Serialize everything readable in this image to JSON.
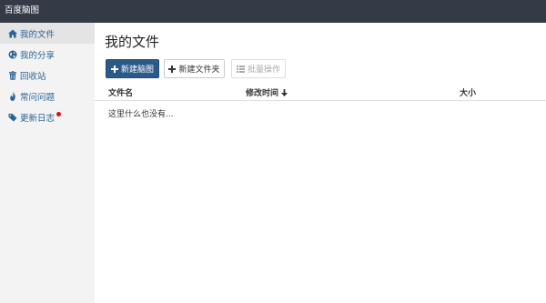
{
  "app": {
    "title": "百度脑图"
  },
  "sidebar": {
    "items": [
      {
        "label": "我的文件",
        "icon": "home-icon",
        "active": true
      },
      {
        "label": "我的分享",
        "icon": "globe-icon",
        "active": false
      },
      {
        "label": "回收站",
        "icon": "trash-icon",
        "active": false
      },
      {
        "label": "常问问题",
        "icon": "fire-icon",
        "active": false
      },
      {
        "label": "更新日志",
        "icon": "tags-icon",
        "active": false,
        "badge": "red-dot"
      }
    ]
  },
  "main": {
    "title": "我的文件",
    "buttons": {
      "new_mindmap": "新建脑图",
      "new_folder": "新建文件夹",
      "batch": "批量操作"
    },
    "table": {
      "columns": {
        "name": "文件名",
        "modified": "修改时间",
        "size": "大小"
      },
      "sort": "modified-desc",
      "empty_message": "这里什么也没有..."
    }
  },
  "colors": {
    "topbar": "#343a46",
    "sidebar": "#f3f3f3",
    "link": "#2a6496",
    "primary": "#2b5a8a",
    "badge": "#e01010"
  }
}
